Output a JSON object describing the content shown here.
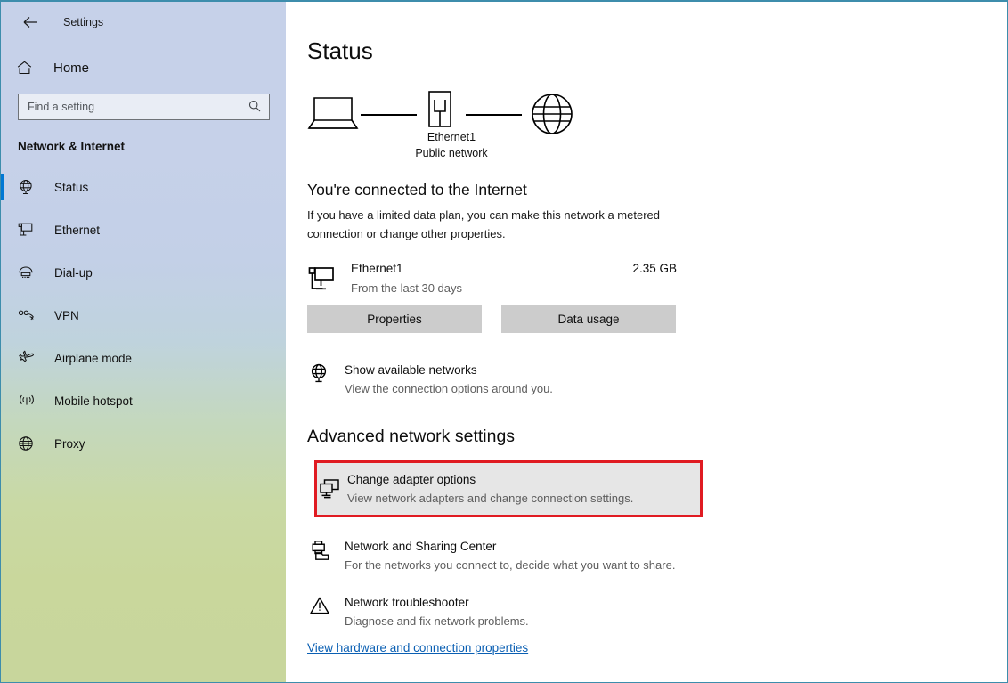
{
  "window": {
    "app_title": "Settings",
    "back_icon": "back-arrow-icon",
    "controls": {
      "minimize": "—",
      "maximize": "□",
      "close": "✕"
    },
    "border_color": "#3d8dac"
  },
  "sidebar": {
    "home_label": "Home",
    "home_icon": "home-icon",
    "search": {
      "placeholder": "Find a setting",
      "value": "",
      "icon": "search-icon"
    },
    "category": "Network & Internet",
    "accent_color": "#0078d4",
    "items": [
      {
        "label": "Status",
        "icon": "status-globe-icon",
        "active": true
      },
      {
        "label": "Ethernet",
        "icon": "ethernet-icon",
        "active": false
      },
      {
        "label": "Dial-up",
        "icon": "dialup-icon",
        "active": false
      },
      {
        "label": "VPN",
        "icon": "vpn-icon",
        "active": false
      },
      {
        "label": "Airplane mode",
        "icon": "airplane-icon",
        "active": false
      },
      {
        "label": "Mobile hotspot",
        "icon": "mobile-hotspot-icon",
        "active": false
      },
      {
        "label": "Proxy",
        "icon": "proxy-globe-icon",
        "active": false
      }
    ]
  },
  "main": {
    "page_title": "Status",
    "diagram": {
      "device_icon": "laptop-icon",
      "network_icon": "network-adapter-icon",
      "internet_icon": "globe-icon",
      "network_name": "Ethernet1",
      "network_type": "Public network"
    },
    "connection": {
      "heading": "You're connected to the Internet",
      "description": "If you have a limited data plan, you can make this network a metered connection or change other properties."
    },
    "usage": {
      "icon": "monitor-network-icon",
      "adapter_name": "Ethernet1",
      "period": "From the last 30 days",
      "amount": "2.35 GB",
      "properties_button": "Properties",
      "data_usage_button": "Data usage"
    },
    "show_networks": {
      "icon": "available-networks-icon",
      "title": "Show available networks",
      "subtitle": "View the connection options around you."
    },
    "advanced_heading": "Advanced network settings",
    "advanced_items": [
      {
        "icon": "change-adapter-icon",
        "title": "Change adapter options",
        "subtitle": "View network adapters and change connection settings.",
        "highlighted": true,
        "highlight_color": "#e01b22"
      },
      {
        "icon": "sharing-center-icon",
        "title": "Network and Sharing Center",
        "subtitle": "For the networks you connect to, decide what you want to share.",
        "highlighted": false
      },
      {
        "icon": "troubleshooter-warning-icon",
        "title": "Network troubleshooter",
        "subtitle": "Diagnose and fix network problems.",
        "highlighted": false
      }
    ],
    "hardware_link": "View hardware and connection properties",
    "link_color": "#0a5fb3"
  }
}
